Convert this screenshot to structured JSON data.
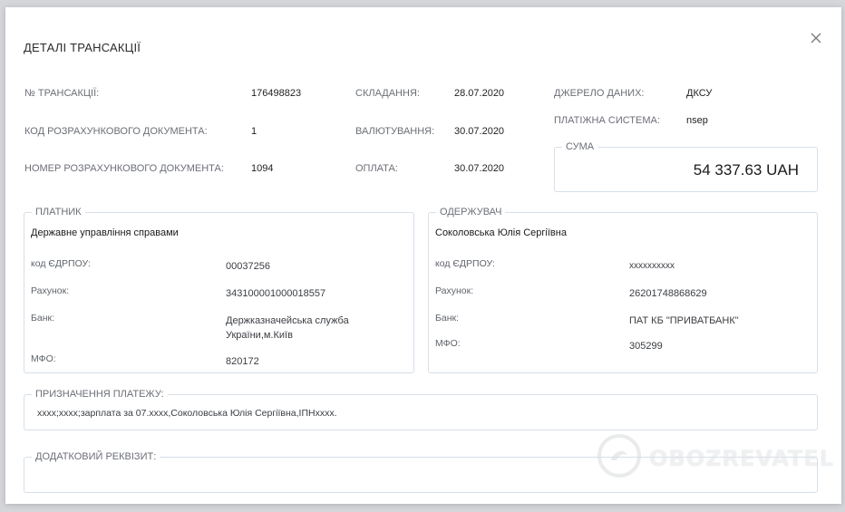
{
  "modal": {
    "title": "ДЕТАЛІ ТРАНСАКЦІЇ"
  },
  "transaction": {
    "number_label": "№ ТРАНСАКЦІЇ:",
    "number_value": "176498823",
    "doc_code_label": "КОД РОЗРАХУНКОВОГО ДОКУМЕНТА:",
    "doc_code_value": "1",
    "doc_number_label": "НОМЕР РОЗРАХУНКОВОГО ДОКУМЕНТА:",
    "doc_number_value": "1094",
    "compiled_label": "СКЛАДАННЯ:",
    "compiled_value": "28.07.2020",
    "valuation_label": "ВАЛЮТУВАННЯ:",
    "valuation_value": "30.07.2020",
    "payment_label": "ОПЛАТА:",
    "payment_value": "30.07.2020",
    "source_label": "ДЖЕРЕЛО ДАНИХ:",
    "source_value": "ДКСУ",
    "system_label": "ПЛАТІЖНА СИСТЕМА:",
    "system_value": "nsep",
    "sum_label": "СУМА",
    "sum_value": "54 337.63 UAH"
  },
  "payer": {
    "legend": "ПЛАТНИК",
    "name": "Державне управління справами",
    "edrpou_label": "код ЄДРПОУ:",
    "edrpou_value": "00037256",
    "account_label": "Рахунок:",
    "account_value": "343100001000018557",
    "bank_label": "Банк:",
    "bank_value": "Держказначейська служба України,м.Київ",
    "mfo_label": "МФО:",
    "mfo_value": "820172"
  },
  "recipient": {
    "legend": "ОДЕРЖУВАЧ",
    "name": "Соколовська Юлія Сергіївна",
    "edrpou_label": "код ЄДРПОУ:",
    "edrpou_value": "xxxxxxxxxx",
    "account_label": "Рахунок:",
    "account_value": "26201748868629",
    "bank_label": "Банк:",
    "bank_value": "ПАТ КБ \"ПРИВАТБАНК\"",
    "mfo_label": "МФО:",
    "mfo_value": "305299"
  },
  "purpose": {
    "legend": "ПРИЗНАЧЕННЯ ПЛАТЕЖУ:",
    "text": "xxxx;xxxx;зарплата за 07.xxxx,Соколовська Юлія Сергіївна,ІПНxxxx."
  },
  "extra": {
    "legend": "ДОДАТКОВИЙ РЕКВІЗИТ:",
    "text": ""
  },
  "watermark": {
    "text": "OBOZREVATEL",
    "icon": "obozrevatel-logo-icon"
  }
}
